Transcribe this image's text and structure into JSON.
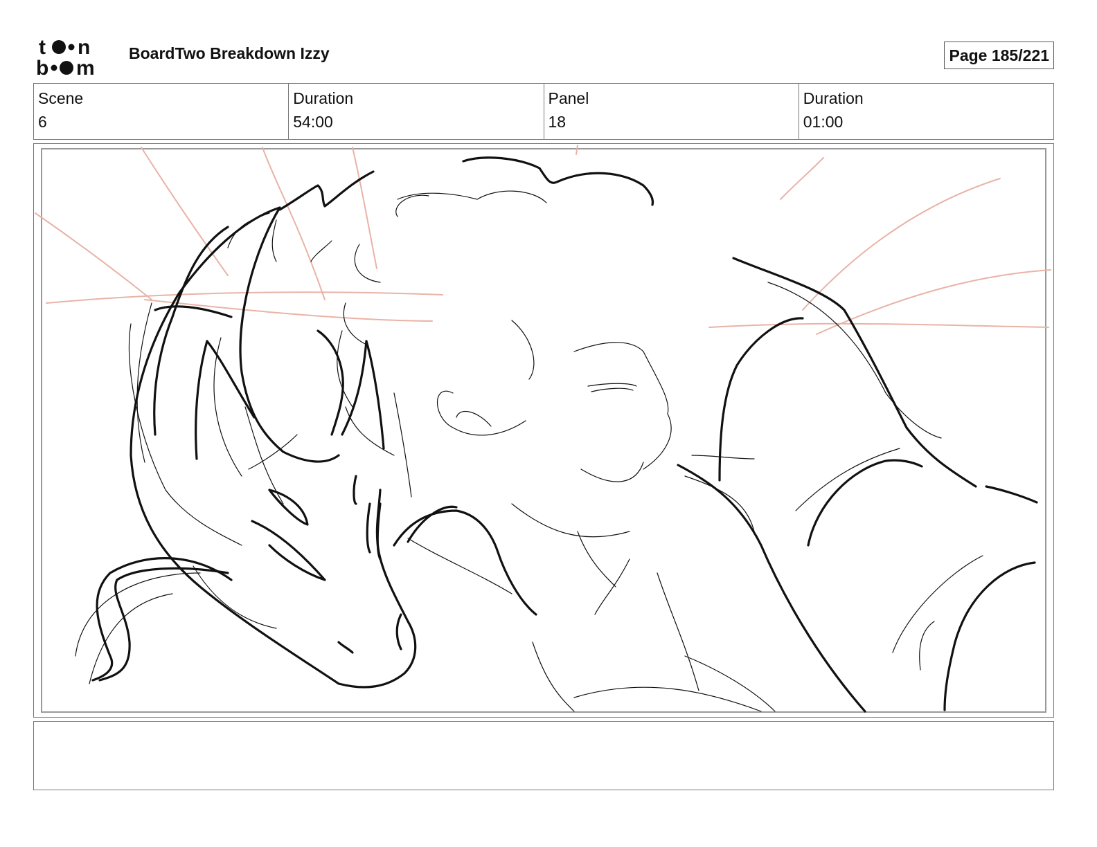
{
  "header": {
    "logo_text": "toon boom",
    "title": "BoardTwo Breakdown Izzy",
    "page": "Page 185/221"
  },
  "info": {
    "scene_label": "Scene",
    "scene_value": "6",
    "scene_duration_label": "Duration",
    "scene_duration_value": "54:00",
    "panel_label": "Panel",
    "panel_value": "18",
    "panel_duration_label": "Duration",
    "panel_duration_value": "01:00"
  },
  "notes": {
    "text": ""
  },
  "colors": {
    "ink": "#111111",
    "guide_lines": "#e8b3a6",
    "frame": "#777777"
  }
}
